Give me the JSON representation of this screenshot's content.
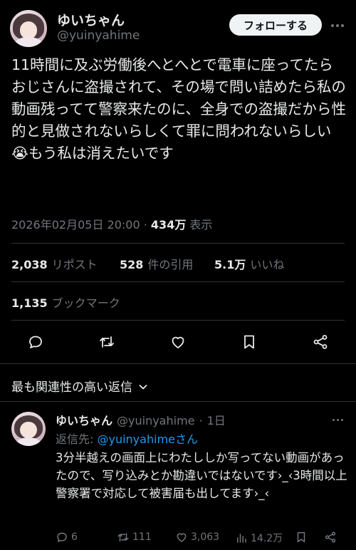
{
  "author": {
    "name": "ゆいちゃん",
    "handle": "@yuinyahime"
  },
  "follow_label": "フォローする",
  "tweet": {
    "text": "11時間に及ぶ労働後へとへとで電車に座ってたらおじさんに盗撮されて、その場で問い詰めたら私の動画残ってて警察来たのに、全身での盗撮だから性的と見做されないらしくて罪に問われないらしい😭もう私は消えたいです",
    "timestamp": "2026年02月05日 20:00",
    "separator": "·",
    "views_count": "434万",
    "views_label": "表示"
  },
  "stats": {
    "reposts_count": "2,038",
    "reposts_label": "リポスト",
    "quotes_count": "528",
    "quotes_label": "件の引用",
    "likes_count": "5.1万",
    "likes_label": "いいね",
    "bookmarks_count": "1,135",
    "bookmarks_label": "ブックマーク"
  },
  "actions": [
    "reply-icon",
    "repost-icon",
    "like-icon",
    "bookmark-icon",
    "share-icon"
  ],
  "replies_section": {
    "title": "最も関連性の高い返信",
    "chevron": "chevron-down-icon"
  },
  "reply": {
    "name": "ゆいちゃん",
    "handle": "@yuinyahime",
    "dot": "·",
    "age": "1日",
    "reply_to_prefix": "返信先: ",
    "reply_to_handle": "@yuinyahime",
    "reply_to_suffix": "さん",
    "text": "3分半越えの画面上にわたししか写ってない動画があったので、写り込みとか勘違いではないです›_‹3時間以上警察署で対応して被害届も出してます›_‹",
    "replies": "6",
    "reposts": "111",
    "likes": "3,063",
    "views": "14.2万"
  },
  "colors": {
    "background": "#000000",
    "text": "#e7e9ea",
    "secondary": "#71767b",
    "link": "#1d9bf0",
    "divider": "#2f3336",
    "follow_bg": "#eff3f4"
  }
}
